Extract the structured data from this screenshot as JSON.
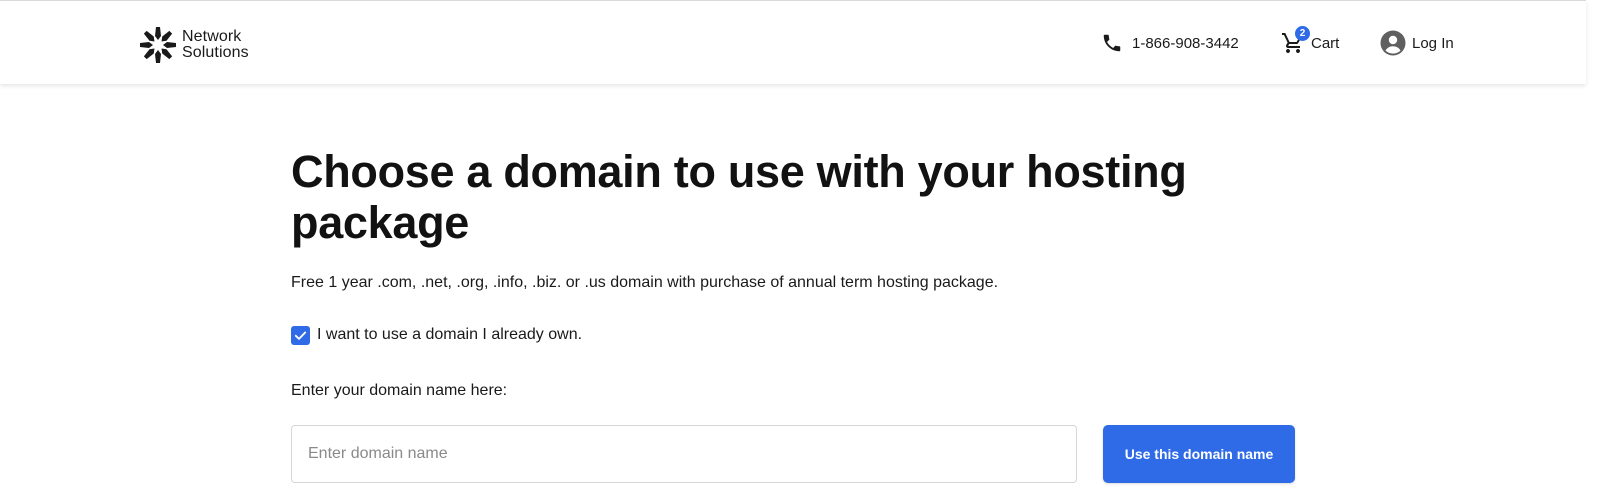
{
  "header": {
    "logo": {
      "line1": "Network",
      "line2": "Solutions"
    },
    "phone": {
      "number": "1-866-908-3442",
      "icon": "phone-icon"
    },
    "cart": {
      "label": "Cart",
      "count": "2",
      "icon": "cart-icon"
    },
    "login": {
      "label": "Log In",
      "icon": "account-circle-icon"
    }
  },
  "main": {
    "title": "Choose a domain to use with your hosting package",
    "subtext": "Free 1 year .com, .net, .org, .info, .biz. or .us domain with purchase of annual term hosting package.",
    "own_domain_checkbox": {
      "label": "I want to use a domain I already own.",
      "checked": true
    },
    "field_label": "Enter your domain name here:",
    "domain_input": {
      "value": "",
      "placeholder": "Enter domain name"
    },
    "submit_button": "Use this domain name"
  },
  "colors": {
    "accent": "#2f6be6",
    "text": "#1a1a1a",
    "input_border": "#d6d6d6",
    "placeholder": "#8a8a8a"
  }
}
